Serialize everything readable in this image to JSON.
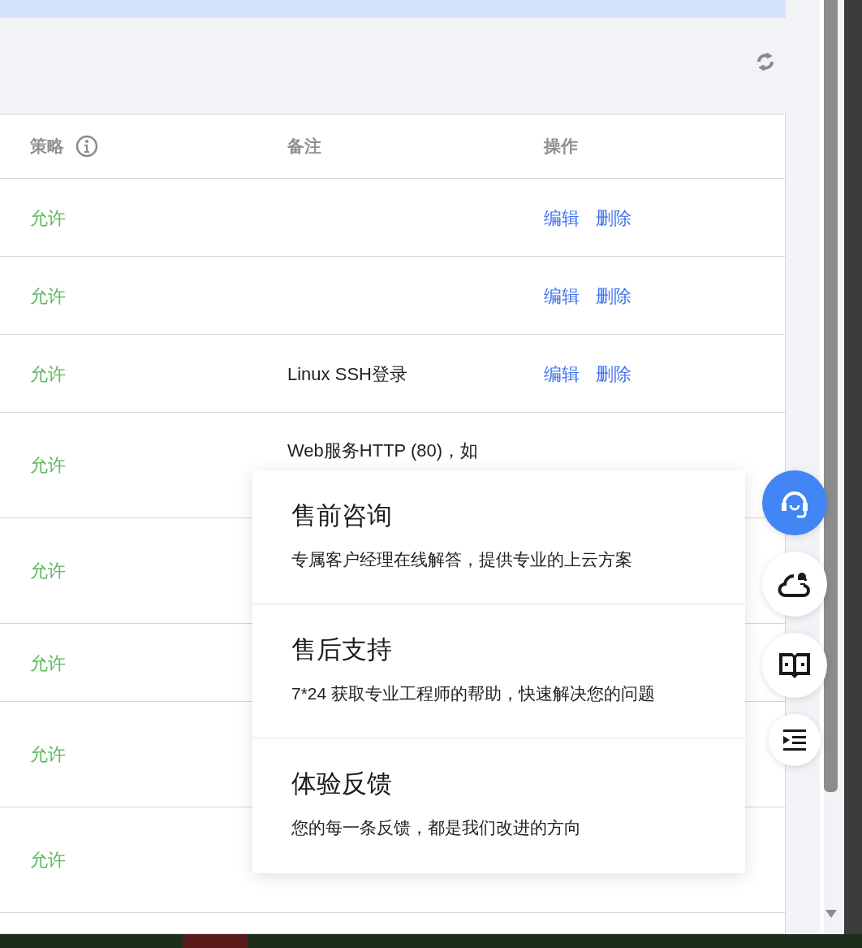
{
  "table": {
    "columns": [
      {
        "label": "策略",
        "kind": "info"
      },
      {
        "label": "备注",
        "kind": "plain"
      },
      {
        "label": "操作",
        "kind": "plain"
      }
    ],
    "rows": [
      {
        "policy": "允许",
        "actions": [
          "编辑",
          "删除"
        ]
      },
      {
        "policy": "允许",
        "actions": [
          "编辑",
          "删除"
        ]
      },
      {
        "policy": "允许",
        "remark": "Linux SSH登录",
        "actions": [
          "编辑",
          "删除"
        ]
      },
      {
        "policy": "允许",
        "remark": "Web服务HTTP (80)，如"
      },
      {
        "policy": "允许"
      },
      {
        "policy": "允许"
      },
      {
        "policy": "允许"
      },
      {
        "policy": "允许"
      }
    ]
  },
  "popup": {
    "items": [
      {
        "title": "售前咨询",
        "desc": "专属客户经理在线解答，提供专业的上云方案"
      },
      {
        "title": "售后支持",
        "desc": "7*24 获取专业工程师的帮助，快速解决您的问题"
      },
      {
        "title": "体验反馈",
        "desc": "您的每一条反馈，都是我们改进的方向"
      }
    ]
  },
  "float_buttons": [
    {
      "kind": "headset",
      "selected": true
    },
    {
      "kind": "cloud",
      "selected": false
    },
    {
      "kind": "book",
      "selected": false
    },
    {
      "kind": "collapse",
      "selected": false
    }
  ]
}
